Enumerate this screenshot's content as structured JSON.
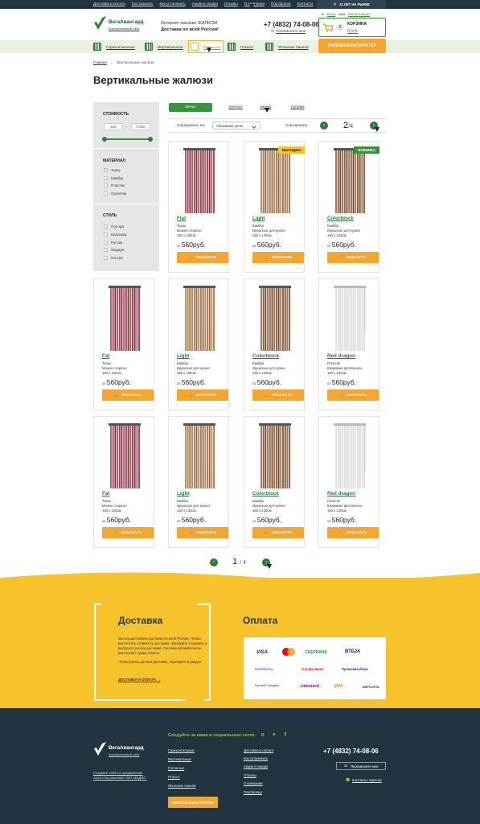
{
  "topnav": {
    "links": [
      "Доставка и оплата",
      "Как заказать",
      "Как установить",
      "Акции и скидки",
      "Отзывы",
      "О компании",
      "Портфолио",
      "Контакты"
    ],
    "years": "12 ЛЕТ НА РЫНКЕ"
  },
  "header": {
    "brand": "ВегаАвангард",
    "brand_sub": "Корпоративный сайт",
    "shop_line": "Интернет-магазин ЖАЛЮЗИ",
    "shop_line2": "Доставка по всей России!",
    "phone": "+7 (4832) 74-08-06",
    "callback": "Перезвоните мне",
    "login": "Вход",
    "or": "или",
    "register": "Регистрация",
    "cart_label": "КОРЗИНА",
    "cart_count": "0",
    "cart_sum": "0 руб."
  },
  "nav": {
    "items": [
      "Горизонтальные",
      "Вертикальные",
      "Рулонные",
      "Плиссе",
      "Японские панели"
    ],
    "constructor": "ОНЛАЙН-КОНСТРУКТОР"
  },
  "breadcrumb": {
    "home": "Главная",
    "sep": "→",
    "current": "Вертикальные жалюзи"
  },
  "page_title": "Вертикальные жалюзи",
  "filter": {
    "price_title": "СТОИМОСТЬ",
    "price_from": "520",
    "price_dash": "-",
    "price_to": "3 500",
    "material_title": "МАТЕРИАЛ",
    "materials": [
      {
        "label": "Ткань",
        "checked": true
      },
      {
        "label": "Бамбук",
        "checked": false
      },
      {
        "label": "Пластик",
        "checked": false
      },
      {
        "label": "Синтетик",
        "checked": false
      }
    ],
    "style_title": "СТИЛЬ",
    "styles": [
      "Поп-арт",
      "Классика",
      "Рустик",
      "Модерн",
      "Контри"
    ]
  },
  "tabs": [
    "Венус",
    "Элегант",
    "Ажиур",
    "Суприм"
  ],
  "sort": {
    "label": "Сортировать по:",
    "value": "Убыванию цены",
    "label2": "Сортировать:",
    "page": "2",
    "total": "/4",
    "prev": "‹",
    "next": "›"
  },
  "card_texts": {
    "price_prefix": "от",
    "order": "ЗАКАЗАТЬ",
    "cart_icon": "cart-icon"
  },
  "badges": {
    "hit": "ВЫГОДНО",
    "new": "НОВИНКА"
  },
  "products": [
    {
      "name": "Flat",
      "line1": "Ткань",
      "line2": "Можно стирать!",
      "size": "150 х 130см.",
      "price": "560руб.",
      "color": "#8a2f3d"
    },
    {
      "name": "Light",
      "line1": "Бамбук",
      "line2": "Идеально для кухни!",
      "size": "150 х 130см.",
      "price": "560руб.",
      "color": "#9a6a3e"
    },
    {
      "name": "Colorblock",
      "line1": "Бамбук",
      "line2": "Идеально для кухни!",
      "size": "150 х 130см.",
      "price": "560руб.",
      "color": "#7a4a2a"
    },
    {
      "name": "Fat",
      "line1": "Ткань",
      "line2": "Можно стирать!",
      "size": "150 х 130см.",
      "price": "560руб.",
      "color": "#8a2f3d"
    },
    {
      "name": "Light",
      "line1": "Бамбук",
      "line2": "Идеально для кухни!",
      "size": "150 х 130см.",
      "price": "560руб.",
      "color": "#9a6a3e"
    },
    {
      "name": "Colorblock",
      "line1": "Бамбук",
      "line2": "Идеально для кухни!",
      "size": "150 х 130см.",
      "price": "560руб.",
      "color": "#7a4a2a"
    },
    {
      "name": "Red dragon",
      "line1": "Пластик",
      "line2": "Возможно фотопечать",
      "size": "150 х 130см.",
      "price": "560руб.",
      "color": "#d9d9d9"
    },
    {
      "name": "Fat",
      "line1": "Ткань",
      "line2": "Можно стирать!",
      "size": "150 х 130см.",
      "price": "560руб.",
      "color": "#8a2f3d"
    },
    {
      "name": "Light",
      "line1": "Бамбук",
      "line2": "Идеально для кухни!",
      "size": "150 х 130см.",
      "price": "560руб.",
      "color": "#9a6a3e"
    },
    {
      "name": "Colorblock",
      "line1": "Бамбук",
      "line2": "Идеально для кухни!",
      "size": "150 х 130см.",
      "price": "560руб.",
      "color": "#7a4a2a"
    },
    {
      "name": "Red dragon",
      "line1": "Пластик",
      "line2": "Возможно фотопечать",
      "size": "150 х 130см.",
      "price": "560руб.",
      "color": "#d9d9d9"
    }
  ],
  "pager": {
    "page": "1",
    "total": "/ 4",
    "prev": "‹",
    "next": "›"
  },
  "delivery": {
    "title": "Доставка",
    "text1": "Мы осуществляем доставку по всей России. Чтобы рассчитать стоимость доставки, перейдите в корзину и выберите регион доставки. Система автоматически рассчитает сумму оплаты.",
    "text2": "Чтобы узнать детали доставки, перейдите в раздел",
    "link": "ДОСТАВКА И ОПЛАТА →"
  },
  "payment": {
    "title": "Оплата",
    "logos": [
      "VISA",
      "MasterCard",
      "СБЕРБАНК",
      "ВТБ24",
      "WebMoney",
      "Альфа-Банк",
      "Промсвязьбанк",
      "Русский Стандарт",
      "СВЯЗНОЙ",
      "QIWI",
      "ЕВРОСЕТЬ"
    ]
  },
  "footer": {
    "social": "Следуйте за нами в социальных сетях",
    "brand": "ВегаАвангард",
    "brand_sub": "Корпоративный сайт",
    "copy1": "Создание сайта и продвижение",
    "copy2": "Агентство решений \"ХИТ МЕДИА\"",
    "col1": [
      "Горизонтальные",
      "Вертикальные",
      "Рулонные",
      "Плиссе",
      "Японские панели"
    ],
    "col2": [
      "Доставка и оплата",
      "Как установить",
      "Акции и скидки",
      "Отзывы",
      "О компании",
      "Портфолио"
    ],
    "phone": "+7 (4832) 74-08-06",
    "callback": "Перезвоните мне",
    "map": "Контакты офисов",
    "constructor": "ОНЛАЙН-КОНСТРУКТОР"
  }
}
